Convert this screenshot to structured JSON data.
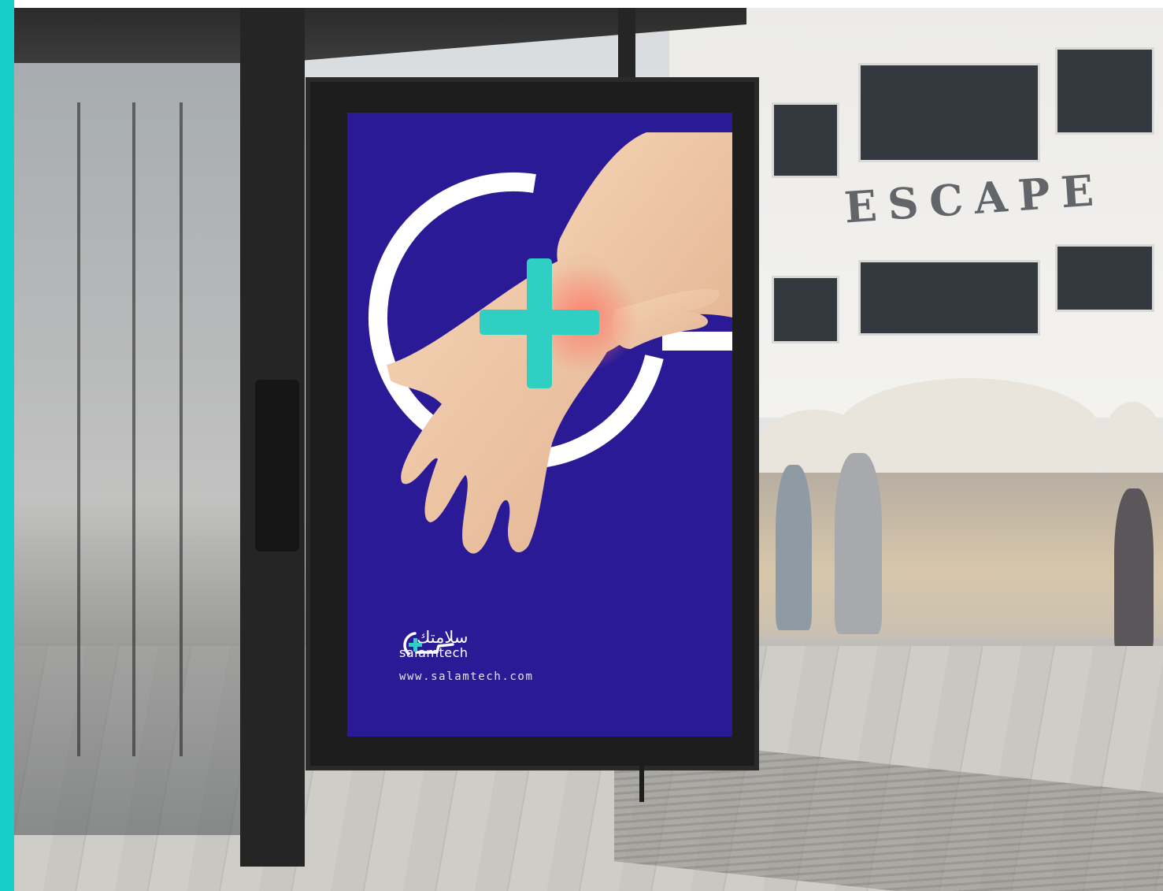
{
  "colors": {
    "accent_bar": "#18cfc7",
    "poster_blue": "#2a1a96",
    "brand_teal": "#2fcfc3"
  },
  "background": {
    "storefront_sign": "ESCAPE"
  },
  "poster": {
    "logo_arabic": "سلامتك",
    "logo_english": "salamtech",
    "website": "www.salamtech.com",
    "icon": "plus-in-circle-logo-icon"
  }
}
